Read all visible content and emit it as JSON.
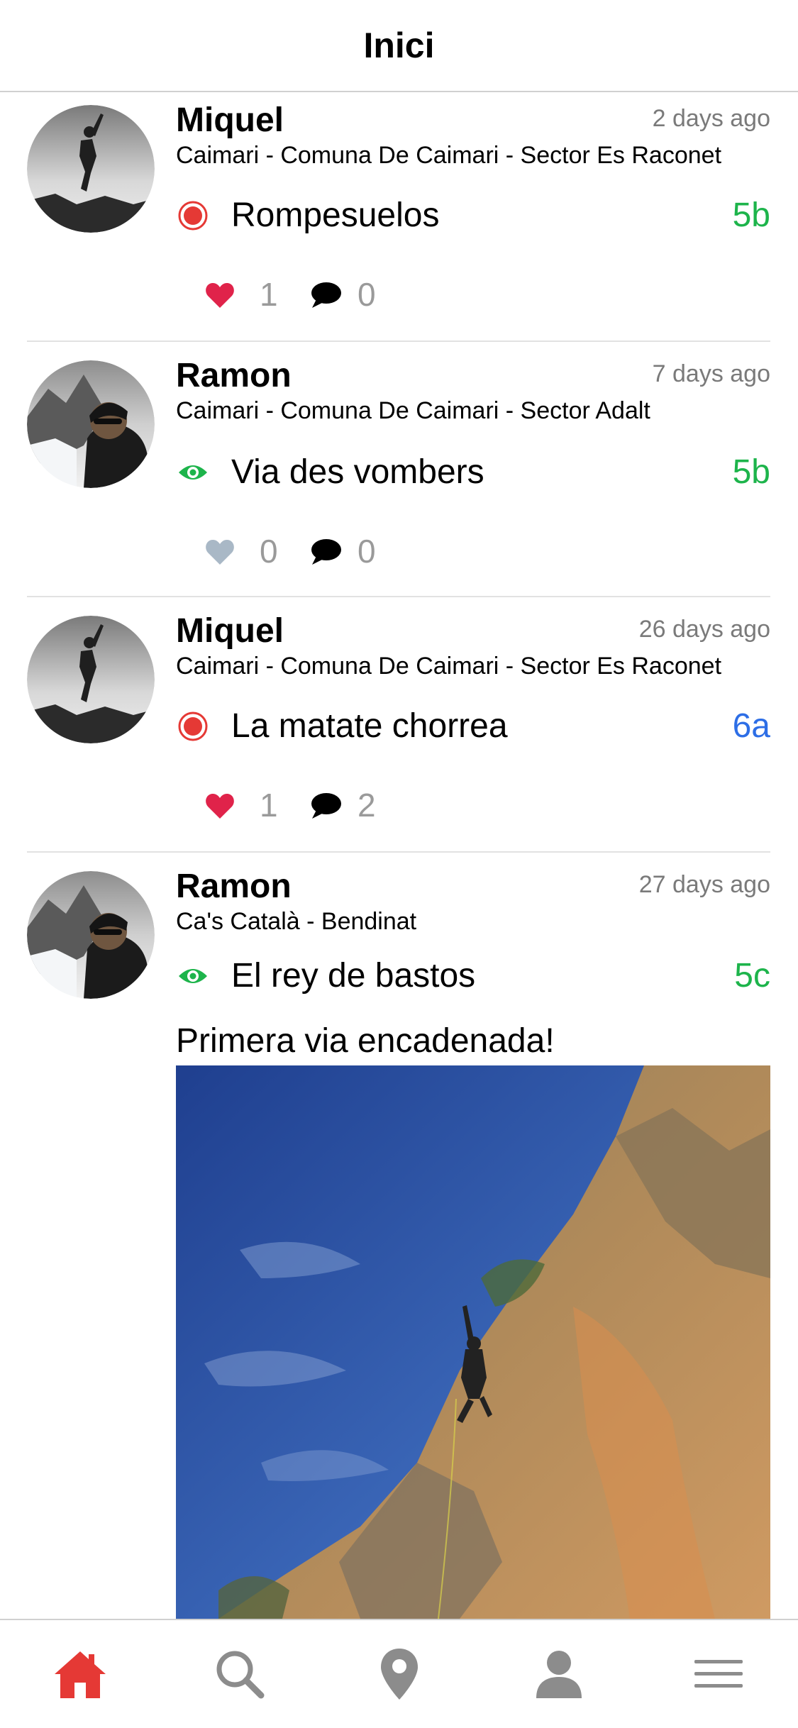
{
  "header": {
    "title": "Inici"
  },
  "colors": {
    "grade_green": "#1db44b",
    "grade_blue": "#2d6ee6",
    "redpoint_red": "#e53935",
    "onsight_green": "#1db44b",
    "like_active": "#e0234a",
    "like_inactive": "#a9b8c6",
    "tab_active": "#e53935",
    "tab_inactive": "#8c8c8c"
  },
  "posts": [
    {
      "user": "Miquel",
      "time": "2 days ago",
      "location": "Caimari - Comuna De Caimari - Sector Es Raconet",
      "route_icon": "redpoint-icon",
      "route": "Rompesuelos",
      "grade": "5b",
      "likes": "1",
      "comments": "0",
      "liked": true
    },
    {
      "user": "Ramon",
      "time": "7 days ago",
      "location": "Caimari - Comuna De Caimari - Sector Adalt",
      "route_icon": "eye-icon",
      "route": "Via des vombers",
      "grade": "5b",
      "likes": "0",
      "comments": "0",
      "liked": false
    },
    {
      "user": "Miquel",
      "time": "26 days ago",
      "location": "Caimari - Comuna De Caimari - Sector Es Raconet",
      "route_icon": "redpoint-icon",
      "route": "La matate chorrea",
      "grade": "6a",
      "likes": "1",
      "comments": "2",
      "liked": true
    },
    {
      "user": "Ramon",
      "time": "27 days ago",
      "location": "Ca's Català - Bendinat",
      "route_icon": "eye-icon",
      "route": "El rey de bastos",
      "grade": "5c",
      "text": "Primera via encadenada!"
    }
  ],
  "tabbar": {
    "items": [
      {
        "icon": "home-icon",
        "active": true
      },
      {
        "icon": "search-icon",
        "active": false
      },
      {
        "icon": "location-pin-icon",
        "active": false
      },
      {
        "icon": "profile-icon",
        "active": false
      },
      {
        "icon": "menu-icon",
        "active": false
      }
    ]
  }
}
